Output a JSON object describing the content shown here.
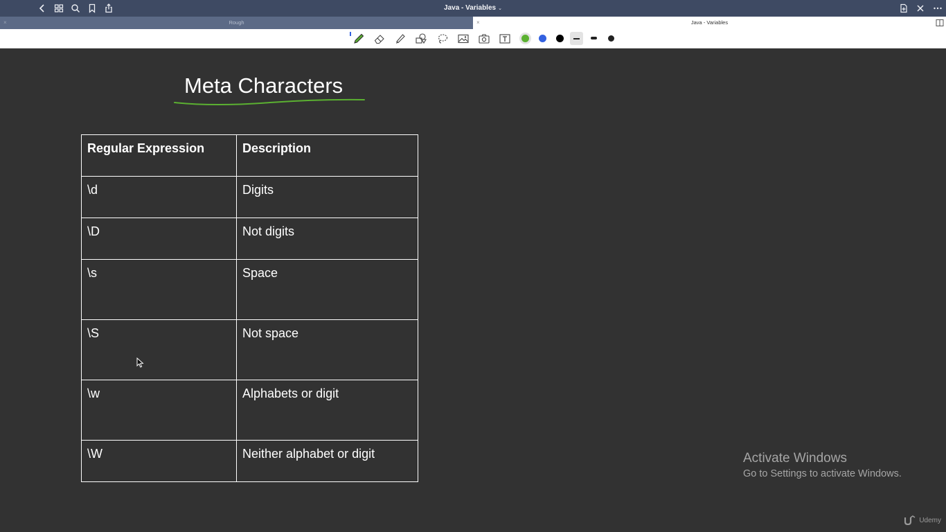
{
  "window": {
    "title": "Java - Variables",
    "title_caret": "⌄"
  },
  "tabs": [
    {
      "label": "Rough",
      "close": "×",
      "active": false
    },
    {
      "label": "Java - Variables",
      "close": "×",
      "active": true
    }
  ],
  "toolbar": {
    "tools": [
      "pen-icon",
      "eraser-icon",
      "highlighter-icon",
      "shapes-icon",
      "lasso-icon",
      "image-icon",
      "camera-icon",
      "text-icon"
    ],
    "colors": [
      "#5bb131",
      "#3361e0",
      "#000000"
    ],
    "selected_color": "#5bb131"
  },
  "page": {
    "title": "Meta Characters",
    "underline_color": "#5bb131",
    "table": {
      "headers": [
        "Regular Expression",
        "Description"
      ],
      "rows": [
        {
          "regex": "\\d",
          "description": "Digits"
        },
        {
          "regex": "\\D",
          "description": "Not digits"
        },
        {
          "regex": "\\s",
          "description": "Space"
        },
        {
          "regex": "\\S",
          "description": "Not space"
        },
        {
          "regex": "\\w",
          "description": "Alphabets or digit"
        },
        {
          "regex": "\\W",
          "description": "Neither alphabet or digit"
        }
      ]
    }
  },
  "watermark": {
    "line1": "Activate Windows",
    "line2": "Go to Settings to activate Windows."
  },
  "brand": {
    "label": "Udemy"
  }
}
